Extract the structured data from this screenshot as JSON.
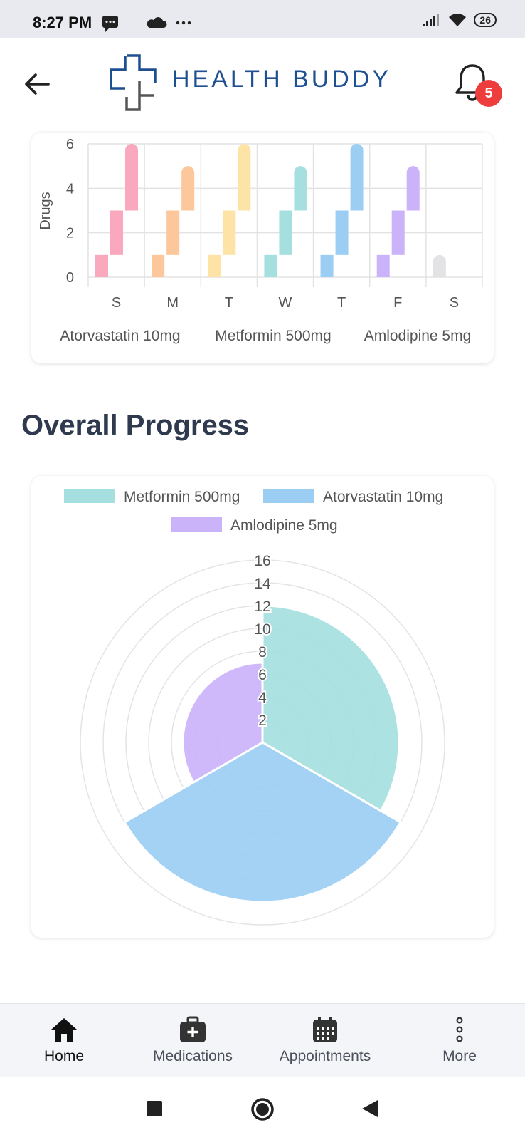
{
  "status": {
    "time": "8:27 PM",
    "battery": "26"
  },
  "header": {
    "app_name": "HEALTH BUDDY",
    "notification_count": "5"
  },
  "weekly_chart": {
    "days": [
      "S",
      "M",
      "T",
      "W",
      "T",
      "F",
      "S"
    ],
    "ylabel": "Drugs",
    "y_ticks": [
      "0",
      "2",
      "4",
      "6"
    ],
    "legend": [
      "Atorvastatin 10mg",
      "Metformin 500mg",
      "Amlodipine 5mg"
    ]
  },
  "section_title": "Overall Progress",
  "radar": {
    "legend": [
      "Metformin 500mg",
      "Atorvastatin 10mg",
      "Amlodipine 5mg"
    ],
    "ticks": [
      "2",
      "4",
      "6",
      "8",
      "10",
      "12",
      "14",
      "16"
    ]
  },
  "nav": {
    "home": "Home",
    "medications": "Medications",
    "appointments": "Appointments",
    "more": "More"
  },
  "colors": {
    "pink": "#f9a8bd",
    "orange": "#fcc89b",
    "yellow": "#fde4a6",
    "teal": "#a6dfdf",
    "blue": "#9ccef3",
    "purple": "#cbb3fa",
    "gray": "#e3e3e5",
    "brand": "#1e4f91",
    "badge": "#ee3d3d"
  },
  "chart_data": [
    {
      "type": "bar",
      "stacked": "floating",
      "categories": [
        "S",
        "M",
        "T",
        "W",
        "T",
        "F",
        "S"
      ],
      "ylabel": "Drugs",
      "ylim": [
        0,
        6
      ],
      "y_ticks": [
        0,
        2,
        4,
        6
      ],
      "grid": true,
      "legend_position": "bottom",
      "series": [
        {
          "name": "Atorvastatin 10mg",
          "ranges": [
            [
              0,
              1
            ],
            [
              0,
              1
            ],
            [
              0,
              1
            ],
            [
              0,
              1
            ],
            [
              0,
              1
            ],
            [
              0,
              1
            ],
            [
              0,
              1
            ]
          ]
        },
        {
          "name": "Metformin 500mg",
          "ranges": [
            [
              1,
              3
            ],
            [
              1,
              3
            ],
            [
              1,
              3
            ],
            [
              1,
              3
            ],
            [
              1,
              3
            ],
            [
              1,
              3
            ],
            null
          ]
        },
        {
          "name": "Amlodipine 5mg",
          "ranges": [
            [
              3,
              6
            ],
            [
              3,
              5
            ],
            [
              3,
              6
            ],
            [
              3,
              5
            ],
            [
              3,
              6
            ],
            [
              3,
              5
            ],
            null
          ]
        }
      ],
      "day_colors": [
        "pink",
        "orange",
        "yellow",
        "teal",
        "blue",
        "purple",
        "gray"
      ]
    },
    {
      "type": "polar-area",
      "legend_position": "top",
      "r_range": [
        0,
        16
      ],
      "r_ticks": [
        2,
        4,
        6,
        8,
        10,
        12,
        14,
        16
      ],
      "series": [
        {
          "name": "Metformin 500mg",
          "value": 12,
          "color": "teal"
        },
        {
          "name": "Atorvastatin 10mg",
          "value": 14,
          "color": "blue"
        },
        {
          "name": "Amlodipine 5mg",
          "value": 7,
          "color": "purple"
        }
      ]
    }
  ]
}
